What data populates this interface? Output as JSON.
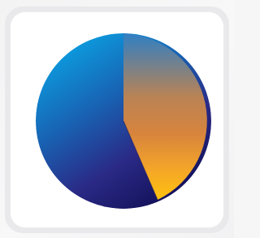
{
  "icon": {
    "name": "pie-chart-app-icon",
    "colors": {
      "page_background": "#f6f6f7",
      "tile_border": "#e9e9eb",
      "tile_fill": "#ffffff",
      "blue_light": "#0aa3e4",
      "blue_mid": "#1864b4",
      "indigo": "#2a2a86",
      "navy": "#0d0a4e",
      "slate_blue": "#2f7fc4",
      "orange": "#d7843d",
      "amber": "#f4a628",
      "yellow": "#ffc20e"
    },
    "segments": [
      {
        "id": "orange-slice",
        "share": 0.41
      },
      {
        "id": "navy-slice",
        "share": 0.21
      },
      {
        "id": "blue-slice",
        "share": 0.38
      }
    ]
  }
}
